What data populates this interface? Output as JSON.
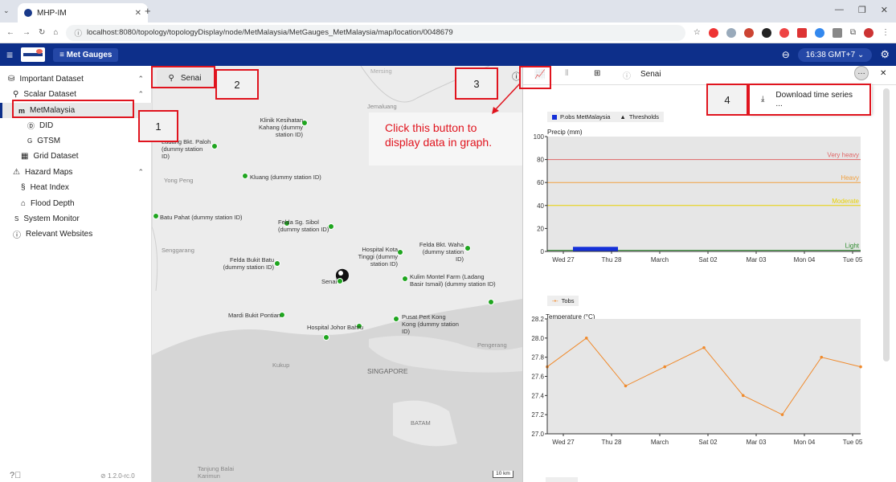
{
  "browser": {
    "tab_title": "MHP-IM",
    "url": "localhost:8080/topology/topologyDisplay/node/MetMalaysia/MetGauges_MetMalaysia/map/location/0048679"
  },
  "appbar": {
    "layer_button": "Met Gauges",
    "time": "16:38 GMT+7"
  },
  "sidebar": {
    "important_dataset": "Important Dataset",
    "scalar_dataset": "Scalar Dataset",
    "metmalaysia": "MetMalaysia",
    "did": "DID",
    "gtsm": "GTSM",
    "grid_dataset": "Grid Dataset",
    "hazard_maps": "Hazard Maps",
    "heat_index": "Heat Index",
    "flood_depth": "Flood Depth",
    "system_monitor": "System Monitor",
    "relevant_websites": "Relevant Websites",
    "version": "1.2.0-rc.0"
  },
  "map": {
    "location_chip": "Senai",
    "selected_label": "Senai",
    "scale": "10 km",
    "stations": [
      "Klinik Kesihatan Kahang (dummy station ID)",
      "Ladang Bkt. Paloh (dummy station ID)",
      "Kluang (dummy station ID)",
      "Batu Pahat (dummy station ID)",
      "Felda Sg. Sibol (dummy station ID)",
      "Felda Bukit Batu (dummy station ID)",
      "Hospital Kota Tinggi (dummy station ID)",
      "Felda Bkt. Waha (dummy station ID)",
      "Kulim Montel Farm (Ladang Basir Ismail) (dummy station ID)",
      "Mardi Bukit Pontian",
      "Hospital Johor Bahru",
      "Pusat Pert Kong Kong (dummy station ID)"
    ],
    "places": [
      "Jemaluang",
      "Yong Peng",
      "Senggarang",
      "Kukup",
      "SINGAPORE",
      "Pengerang",
      "BATAM",
      "Tanjung Balai Karimun",
      "Mersing"
    ]
  },
  "panel": {
    "title": "Senai",
    "menu_item": "Download time series ..."
  },
  "annotations": {
    "n1": "1",
    "n2": "2",
    "n3": "3",
    "n4": "4",
    "callout": "Click this button to display data in graph."
  },
  "chart_data": [
    {
      "type": "bar",
      "legend": [
        "P.obs MetMalaysia",
        "Thresholds"
      ],
      "ylabel": "Precip (mm)",
      "ylim": [
        0,
        100
      ],
      "yticks": [
        0,
        20,
        40,
        60,
        80,
        100
      ],
      "xticks": [
        "Wed 27",
        "Thu 28",
        "March",
        "Sat 02",
        "Mar 03",
        "Mon 04",
        "Tue 05"
      ],
      "series": [
        {
          "name": "P.obs MetMalaysia",
          "x": [
            "Wed 27 12:00",
            "Thu 28 12:00"
          ],
          "values": [
            4,
            4
          ]
        }
      ],
      "thresholds": [
        {
          "label": "Very heavy",
          "value": 80,
          "color": "#e06666"
        },
        {
          "label": "Heavy",
          "value": 60,
          "color": "#f0a040"
        },
        {
          "label": "Moderate",
          "value": 40,
          "color": "#e8d000"
        },
        {
          "label": "Light",
          "value": 1,
          "color": "#2e8b2e"
        }
      ]
    },
    {
      "type": "line",
      "legend": [
        "Tobs"
      ],
      "ylabel": "Temperature (°C)",
      "ylim": [
        27.0,
        28.2
      ],
      "yticks": [
        "27.0",
        "27.2",
        "27.4",
        "27.6",
        "27.8",
        "28.0",
        "28.2"
      ],
      "xticks": [
        "Wed 27",
        "Thu 28",
        "March",
        "Sat 02",
        "Mar 03",
        "Mon 04",
        "Tue 05"
      ],
      "series": [
        {
          "name": "Tobs",
          "values": [
            27.7,
            28.0,
            27.5,
            27.7,
            27.9,
            27.4,
            27.2,
            27.8,
            27.7
          ]
        }
      ]
    }
  ]
}
